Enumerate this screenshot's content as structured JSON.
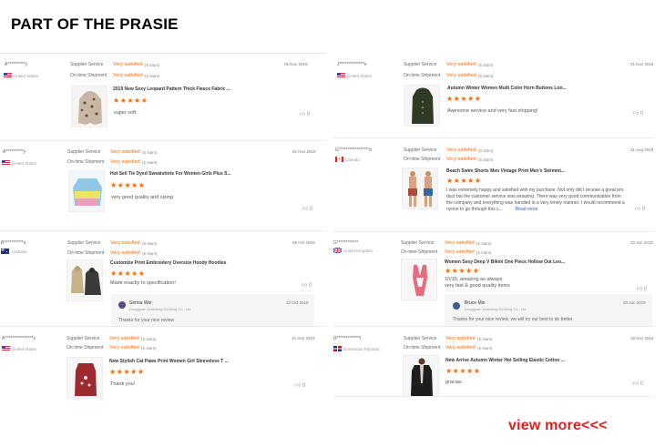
{
  "page_title": "PART OF THE PRASIE",
  "view_more": "view more<<<",
  "labels": {
    "supplier_service": "Supplier Service",
    "ontime_shipment": "On-time Shipment"
  },
  "colors": {
    "accent": "#ff6a00",
    "link": "#2962c7",
    "view_more": "#e02020"
  },
  "reviews": [
    {
      "user": "A**********y",
      "country": "United States",
      "flag": "us-flag",
      "supplier_value": "Very satisfied",
      "supplier_stars": "(5 stars)",
      "shipment_value": "Very satisfied",
      "shipment_stars": "(5 stars)",
      "date": "05 Nov 2019",
      "product": "2019 New Sexy Leopard Pattern Thick Fleece Fabric ...",
      "rating": "★★★★★",
      "comment": "super soft",
      "helpful": "0"
    },
    {
      "user": "A**********y",
      "country": "United States",
      "flag": "us-flag",
      "supplier_value": "Very satisfied",
      "supplier_stars": "(5 stars)",
      "shipment_value": "Very satisfied",
      "shipment_stars": "(5 stars)",
      "date": "01 Nov 2019",
      "product": "Hot Sell Tie Dyed Sweatshirts For Women Girls Plus S...",
      "rating": "★★★★★",
      "comment": "very good quality and sizing",
      "helpful": "0"
    },
    {
      "user": "B***********s",
      "country": "Australia",
      "flag": "au-flag",
      "supplier_value": "Very satisfied",
      "supplier_stars": "(5 stars)",
      "shipment_value": "Very satisfied",
      "shipment_stars": "(5 stars)",
      "date": "09 Oct 2019",
      "product": "Customize Print Embroidery Oversize Hoody Hoodies",
      "rating": "★★★★★",
      "comment": "Made exactly to specification!",
      "helpful": "0",
      "reply": {
        "name": "Serina Wei",
        "company": "Dongguan Huisheng Clothing Co., Ltd",
        "date": "13 Oct 2019",
        "text": "Thanks for your nice review"
      }
    },
    {
      "user": "A****************s",
      "country": "United States",
      "flag": "us-flag",
      "supplier_value": "Very satisfied",
      "supplier_stars": "(5 stars)",
      "shipment_value": "Very satisfied",
      "shipment_stars": "(5 stars)",
      "date": "10 Sep 2019",
      "product": "New Stylish Cat Paws Print Women Girl Sleeveless T ...",
      "rating": "★★★★★",
      "comment": "Thank you!",
      "helpful": "0"
    },
    {
      "user": "J**************e",
      "country": "United States",
      "flag": "us-flag",
      "supplier_value": "Very satisfied",
      "supplier_stars": "(5 stars)",
      "shipment_value": "Very satisfied",
      "shipment_stars": "(5 stars)",
      "date": "21 Nov 2018",
      "product": "Autumn Winter Women Multi Color Horn Buttons Lon...",
      "rating": "★★★★★",
      "comment": "Awesome service and very fast shipping!",
      "helpful": "0"
    },
    {
      "user": "G*****************d",
      "country": "Canada",
      "flag": "ca-flag",
      "supplier_value": "Very satisfied",
      "supplier_stars": "(5 stars)",
      "shipment_value": "Very satisfied",
      "shipment_stars": "(5 stars)",
      "date": "21 Aug 2018",
      "product": "Beach Swim Shorts Men Vintage Print Men's Swimmi...",
      "rating": "★★★★★",
      "comment_lines": [
        "I was extremely happy and satisfied with my purchase. Not only did I receive a great pro",
        "duct but the customer service was amazing. There was very good communication from",
        "the company and everything was handled in a very timely manner. I would recommend a",
        "nyone to go through this c..."
      ],
      "read_more": "Read more",
      "helpful": "0"
    },
    {
      "user": "G************:",
      "country": "United Kingdom",
      "flag": "uk-flag",
      "supplier_value": "Very satisfied",
      "supplier_stars": "(5 stars)",
      "shipment_value": "Very satisfied",
      "shipment_stars": "(5 stars)",
      "date": "20 Jun 2019",
      "product": "Women Sexy Deep V Bikini One Piece Hollow Out Leo...",
      "rating": "★★★★★",
      "comment_lines": [
        "10/10, amazing as always.",
        "very fast & good quality items"
      ],
      "helpful": "0",
      "reply": {
        "name": "Bruce Min",
        "company": "Dongguan Huisheng Clothing Co., Ltd",
        "date": "20 Jun 2019",
        "text": "Thanks for your nice review, we will try our best to do better."
      }
    },
    {
      "user": "R*************l",
      "country": "Dominican Republic",
      "flag": "do-flag",
      "supplier_value": "Very satisfied",
      "supplier_stars": "(5 stars)",
      "shipment_value": "Very satisfied",
      "shipment_stars": "(5 stars)",
      "date": "19 Nov 2018",
      "product": "New Arrive Autumn Winter Hot Selling Elastic Cotton ...",
      "rating": "★★★★★",
      "comment": "gracias",
      "helpful": "0"
    }
  ]
}
